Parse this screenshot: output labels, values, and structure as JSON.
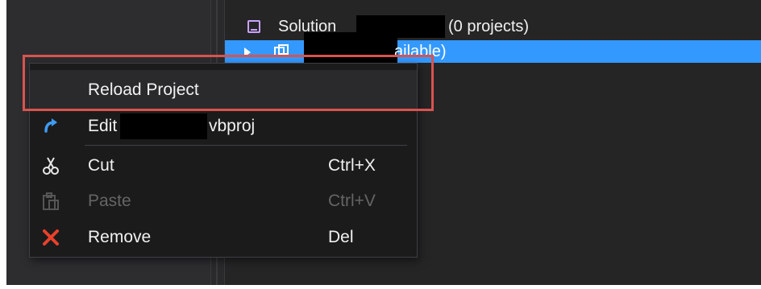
{
  "solution_explorer": {
    "solution_label": "Solution",
    "solution_suffix": "(0 projects)",
    "project_suffix": "ailable)"
  },
  "context_menu": {
    "items": [
      {
        "label": "Reload Project",
        "shortcut": "",
        "icon": "none",
        "enabled": true
      },
      {
        "label": "Edit",
        "label_suffix": "vbproj",
        "shortcut": "",
        "icon": "edit-arrow-icon",
        "enabled": true
      },
      {
        "label": "Cut",
        "shortcut": "Ctrl+X",
        "icon": "scissors-icon",
        "enabled": true
      },
      {
        "label": "Paste",
        "shortcut": "Ctrl+V",
        "icon": "clipboard-icon",
        "enabled": false
      },
      {
        "label": "Remove",
        "shortcut": "Del",
        "icon": "close-icon",
        "enabled": true
      }
    ]
  },
  "colors": {
    "selection": "#3399ff",
    "highlight_box": "#d9534f",
    "remove_icon": "#e8412c",
    "edit_icon": "#3e9cf2"
  }
}
